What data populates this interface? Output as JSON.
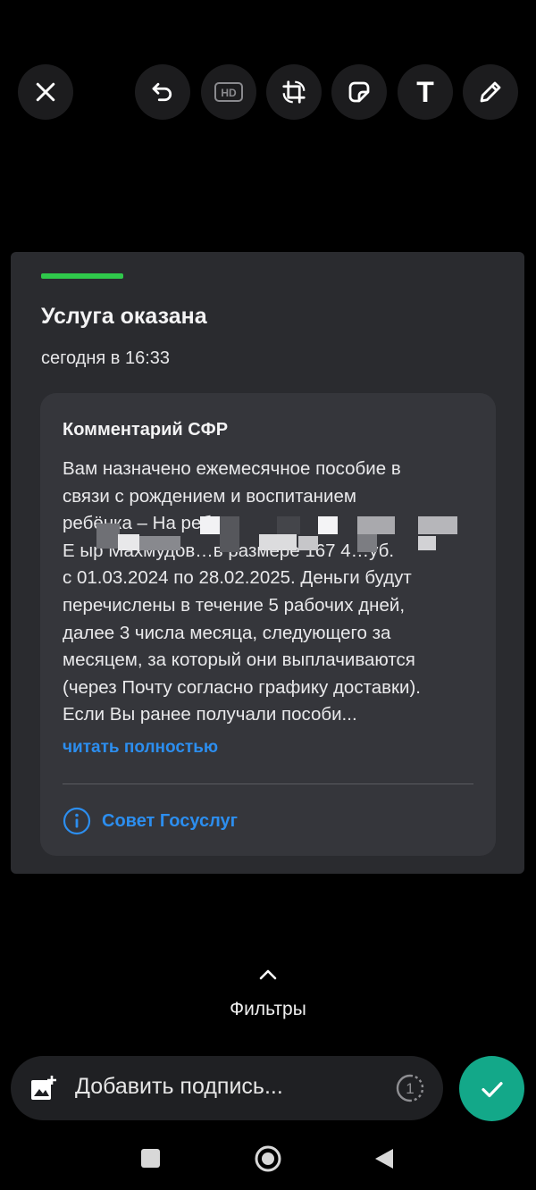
{
  "toolbar": {
    "close_icon": "close-icon",
    "undo_icon": "undo-icon",
    "hd_label": "HD",
    "crop_icon": "crop-rotate-icon",
    "sticker_icon": "sticker-icon",
    "text_label": "T",
    "draw_icon": "pencil-icon"
  },
  "card": {
    "accent_color": "#2fc84b",
    "status_title": "Услуга оказана",
    "status_time": "сегодня в 16:33",
    "comment_title": "Комментарий СФР",
    "comment_lines": [
      "Вам назначено ежемесячное пособие в",
      "связи с рождением и воспитанием",
      "ребёнка – На ребё",
      "Е    ыр Махмудов…в размере 167 4…уб.",
      "с 01.03.2024 по 28.02.2025. Деньги будут",
      "перечислены в течение 5 рабочих дней,",
      "далее 3 числа месяца, следующего за",
      "месяцем, за который они выплачиваются",
      "(через Почту согласно графику доставки).",
      "Если Вы ранее получали пособи..."
    ],
    "read_more": "читать полностью",
    "advice_label": "Совет Госуслуг",
    "link_color": "#2c8eef"
  },
  "filters": {
    "label": "Фильтры"
  },
  "caption": {
    "placeholder": "Добавить подпись...",
    "view_once_label": "1"
  },
  "send": {
    "color": "#13a889"
  }
}
